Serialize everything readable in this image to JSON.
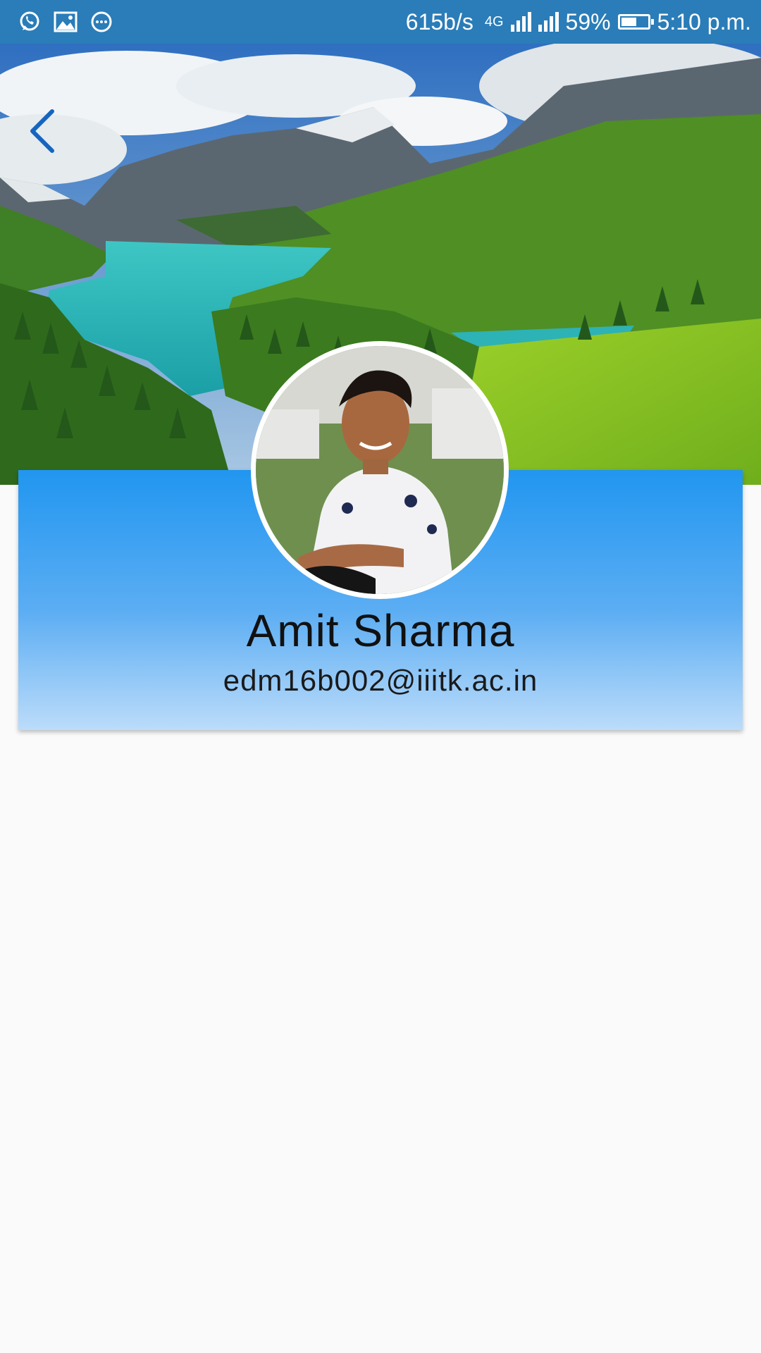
{
  "status_bar": {
    "icons": [
      "whatsapp-icon",
      "gallery-icon",
      "more-dots-icon"
    ],
    "net_speed": "615b/s",
    "network_type": "4G",
    "battery_percent": "59%",
    "battery_level": 0.59,
    "time": "5:10 p.m."
  },
  "header": {
    "back_icon": "chevron-left-icon",
    "accent_color": "#1565c0"
  },
  "profile": {
    "name": "Amit Sharma",
    "email": "edm16b002@iiitk.ac.in"
  },
  "colors": {
    "status_bar": "#2a7db8",
    "card_top": "#2196f0",
    "card_bottom": "#bcdcfa",
    "background": "#fafafa"
  }
}
